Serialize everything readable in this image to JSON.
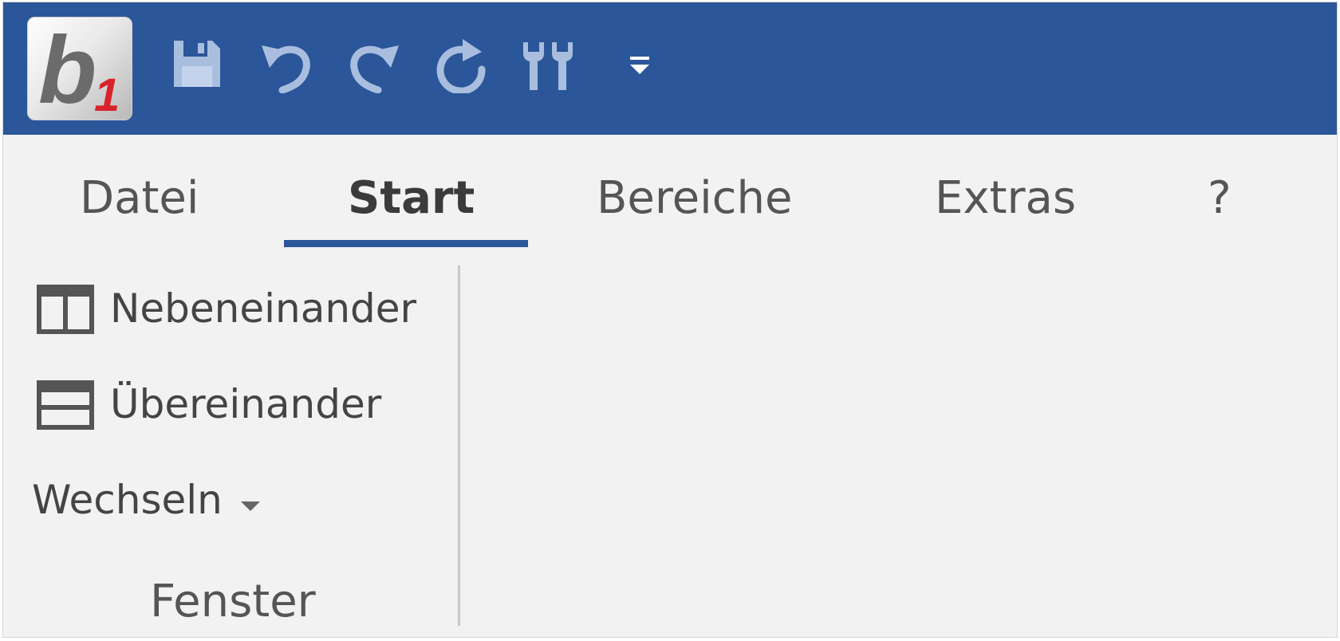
{
  "colors": {
    "titlebar": "#2b5699",
    "background": "#f2f2f2",
    "accent": "#2b5699",
    "logo_b": "#6b6b6b",
    "logo_one": "#d8232a"
  },
  "logo": {
    "letter": "b",
    "subscript": "1"
  },
  "quick_access": {
    "icons": [
      "save-icon",
      "undo-icon",
      "redo-icon",
      "refresh-icon",
      "tools-icon",
      "customize-dropdown-icon"
    ]
  },
  "tabs": [
    {
      "label": "Datei",
      "active": false
    },
    {
      "label": "Start",
      "active": true
    },
    {
      "label": "Bereiche",
      "active": false
    },
    {
      "label": "Extras",
      "active": false
    },
    {
      "label": "?",
      "active": false
    }
  ],
  "ribbon": {
    "group": {
      "label": "Fenster",
      "items": [
        {
          "label": "Nebeneinander",
          "icon": "side-by-side-icon"
        },
        {
          "label": "Übereinander",
          "icon": "stacked-icon"
        }
      ],
      "switch": {
        "label": "Wechseln",
        "icon": "caret-down-icon"
      }
    }
  }
}
